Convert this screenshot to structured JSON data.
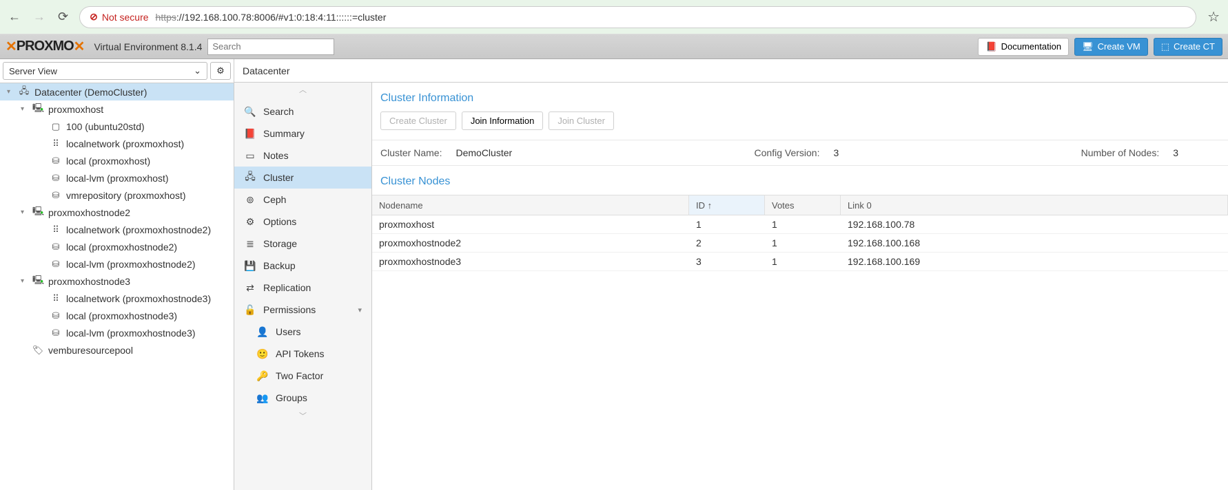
{
  "browser": {
    "not_secure": "Not secure",
    "url_https": "https",
    "url_rest": "://192.168.100.78:8006/#v1:0:18:4:11::::::=cluster"
  },
  "header": {
    "logo_text": "PROXMO",
    "version": "Virtual Environment 8.1.4",
    "search_placeholder": "Search",
    "doc": "Documentation",
    "create_vm": "Create VM",
    "create_ct": "Create CT"
  },
  "left": {
    "view": "Server View",
    "tree": [
      {
        "indent": 0,
        "exp": "▾",
        "icon": "🖧",
        "label": "Datacenter (DemoCluster)",
        "sel": true
      },
      {
        "indent": 1,
        "exp": "▾",
        "icon": "🖳",
        "label": "proxmoxhost",
        "green": true
      },
      {
        "indent": 2,
        "exp": "",
        "icon": "▢",
        "label": "100 (ubuntu20std)"
      },
      {
        "indent": 2,
        "exp": "",
        "icon": "⠿",
        "label": "localnetwork (proxmoxhost)"
      },
      {
        "indent": 2,
        "exp": "",
        "icon": "⛁",
        "label": "local (proxmoxhost)"
      },
      {
        "indent": 2,
        "exp": "",
        "icon": "⛁",
        "label": "local-lvm (proxmoxhost)"
      },
      {
        "indent": 2,
        "exp": "",
        "icon": "⛁",
        "label": "vmrepository (proxmoxhost)"
      },
      {
        "indent": 1,
        "exp": "▾",
        "icon": "🖳",
        "label": "proxmoxhostnode2",
        "green": true
      },
      {
        "indent": 2,
        "exp": "",
        "icon": "⠿",
        "label": "localnetwork (proxmoxhostnode2)"
      },
      {
        "indent": 2,
        "exp": "",
        "icon": "⛁",
        "label": "local (proxmoxhostnode2)"
      },
      {
        "indent": 2,
        "exp": "",
        "icon": "⛁",
        "label": "local-lvm (proxmoxhostnode2)"
      },
      {
        "indent": 1,
        "exp": "▾",
        "icon": "🖳",
        "label": "proxmoxhostnode3",
        "green": true
      },
      {
        "indent": 2,
        "exp": "",
        "icon": "⠿",
        "label": "localnetwork (proxmoxhostnode3)"
      },
      {
        "indent": 2,
        "exp": "",
        "icon": "⛁",
        "label": "local (proxmoxhostnode3)"
      },
      {
        "indent": 2,
        "exp": "",
        "icon": "⛁",
        "label": "local-lvm (proxmoxhostnode3)"
      },
      {
        "indent": 1,
        "exp": "",
        "icon": "🏷",
        "label": "vemburesourcepool"
      }
    ]
  },
  "breadcrumb": "Datacenter",
  "menu": [
    {
      "icon": "🔍",
      "label": "Search"
    },
    {
      "icon": "📕",
      "label": "Summary"
    },
    {
      "icon": "▭",
      "label": "Notes"
    },
    {
      "icon": "🖧",
      "label": "Cluster",
      "sel": true
    },
    {
      "icon": "⊚",
      "label": "Ceph"
    },
    {
      "icon": "⚙",
      "label": "Options"
    },
    {
      "icon": "≣",
      "label": "Storage"
    },
    {
      "icon": "💾",
      "label": "Backup"
    },
    {
      "icon": "⇄",
      "label": "Replication"
    },
    {
      "icon": "🔓",
      "label": "Permissions",
      "chev": "▾"
    },
    {
      "icon": "👤",
      "label": "Users",
      "sub": true
    },
    {
      "icon": "🙂",
      "label": "API Tokens",
      "sub": true
    },
    {
      "icon": "🔑",
      "label": "Two Factor",
      "sub": true
    },
    {
      "icon": "👥",
      "label": "Groups",
      "sub": true
    }
  ],
  "cluster": {
    "info_title": "Cluster Information",
    "btn_create": "Create Cluster",
    "btn_join_info": "Join Information",
    "btn_join": "Join Cluster",
    "name_label": "Cluster Name:",
    "name_val": "DemoCluster",
    "cfg_label": "Config Version:",
    "cfg_val": "3",
    "nodes_label": "Number of Nodes:",
    "nodes_val": "3",
    "nodes_title": "Cluster Nodes",
    "cols": {
      "name": "Nodename",
      "id": "ID",
      "votes": "Votes",
      "link": "Link 0"
    },
    "sort_arrow": "↑",
    "rows": [
      {
        "name": "proxmoxhost",
        "id": "1",
        "votes": "1",
        "link": "192.168.100.78"
      },
      {
        "name": "proxmoxhostnode2",
        "id": "2",
        "votes": "1",
        "link": "192.168.100.168"
      },
      {
        "name": "proxmoxhostnode3",
        "id": "3",
        "votes": "1",
        "link": "192.168.100.169"
      }
    ]
  }
}
